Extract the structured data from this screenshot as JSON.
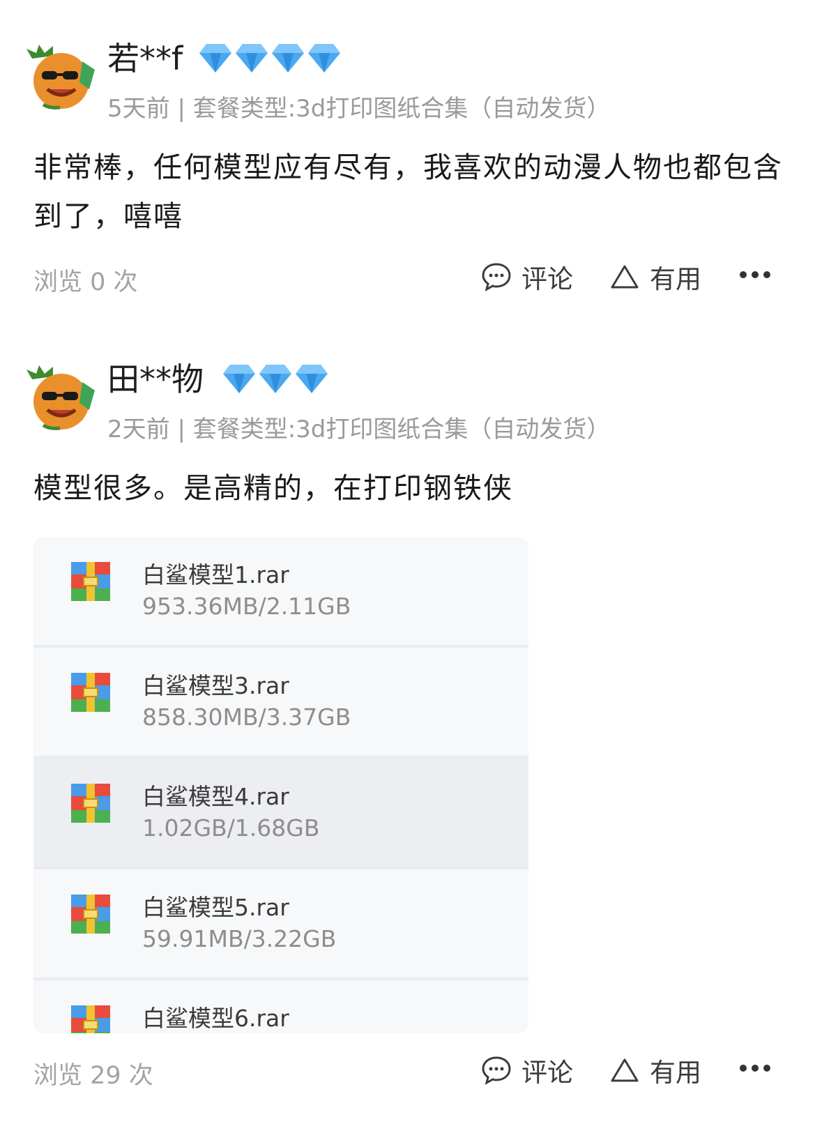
{
  "reviews": [
    {
      "username": "若**f",
      "diamond_count": 4,
      "meta": "5天前 | 套餐类型:3d打印图纸合集（自动发货）",
      "content": "非常棒，任何模型应有尽有，我喜欢的动漫人物也都包含到了，嘻嘻",
      "views": "浏览 0 次",
      "comment_label": "评论",
      "useful_label": "有用"
    },
    {
      "username": "田**物",
      "diamond_count": 3,
      "meta": "2天前 | 套餐类型:3d打印图纸合集（自动发货）",
      "content": "模型很多。是高精的，在打印钢铁侠",
      "views": "浏览 29 次",
      "comment_label": "评论",
      "useful_label": "有用",
      "files": [
        {
          "name": "白鲨模型1.rar",
          "size": "953.36MB/2.11GB"
        },
        {
          "name": "白鲨模型3.rar",
          "size": "858.30MB/3.37GB"
        },
        {
          "name": "白鲨模型4.rar",
          "size": "1.02GB/1.68GB"
        },
        {
          "name": "白鲨模型5.rar",
          "size": "59.91MB/3.22GB"
        },
        {
          "name": "白鲨模型6.rar",
          "size": ""
        }
      ]
    }
  ],
  "icons": {
    "avatar": "orange-mascot-avatar-icon",
    "badge": "diamond-icon",
    "comment": "comment-bubble-icon",
    "useful": "triangle-thumb-icon",
    "more": "more-dots-icon",
    "file": "winrar-archive-icon"
  },
  "colors": {
    "diamond": "#4aa8f0",
    "meta_text": "#9a9a9a",
    "selected_row": "#eceef2"
  }
}
